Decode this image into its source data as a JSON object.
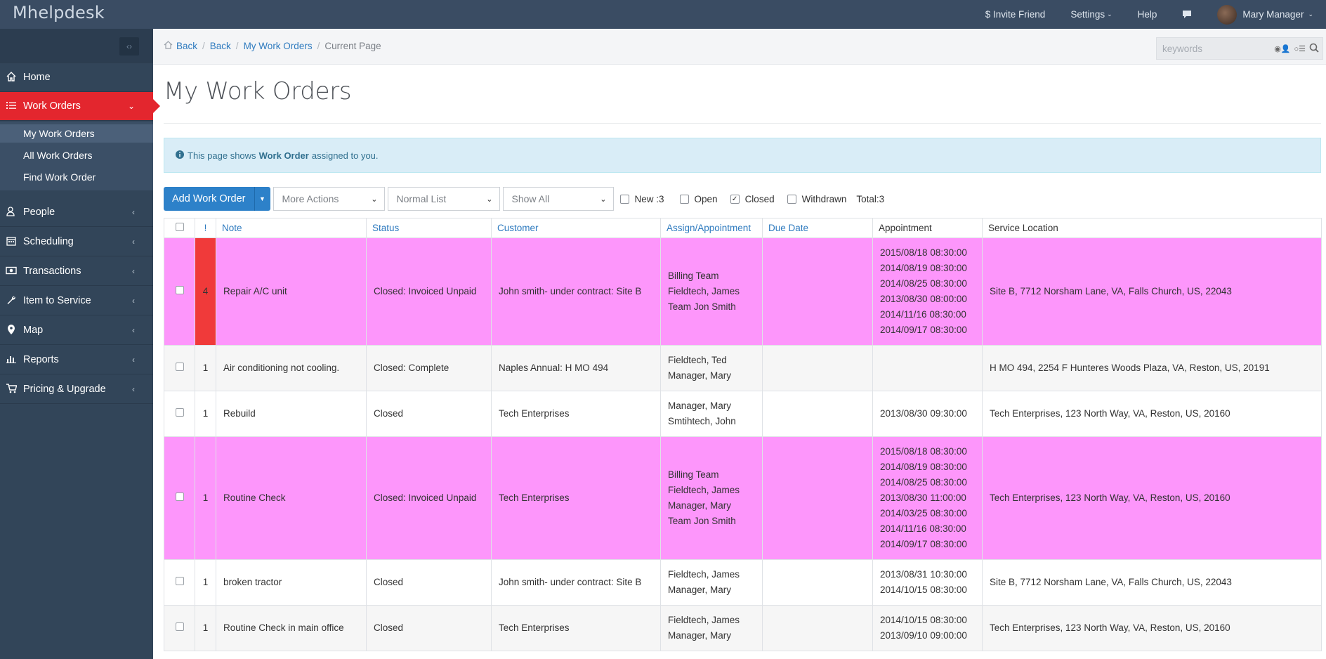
{
  "topbar": {
    "brand": "Mhelpdesk",
    "invite": "$ Invite Friend",
    "settings": "Settings",
    "help": "Help",
    "user": "Mary Manager"
  },
  "sidebar": {
    "items": [
      {
        "label": "Home",
        "icon": "home-icon"
      },
      {
        "label": "Work Orders",
        "icon": "list-icon"
      },
      {
        "label": "People",
        "icon": "people-icon"
      },
      {
        "label": "Scheduling",
        "icon": "calendar-icon"
      },
      {
        "label": "Transactions",
        "icon": "money-icon"
      },
      {
        "label": "Item to Service",
        "icon": "wrench-icon"
      },
      {
        "label": "Map",
        "icon": "map-pin-icon"
      },
      {
        "label": "Reports",
        "icon": "bar-chart-icon"
      },
      {
        "label": "Pricing & Upgrade",
        "icon": "cart-icon"
      }
    ],
    "sub_items": [
      "My Work Orders",
      "All Work Orders",
      "Find Work Order"
    ]
  },
  "breadcrumb": {
    "back1": "Back",
    "back2": "Back",
    "link": "My Work Orders",
    "current": "Current Page"
  },
  "search": {
    "placeholder": "keywords"
  },
  "page": {
    "title": "My Work Orders",
    "info_prefix": "This page shows",
    "info_bold": "Work Order",
    "info_suffix": "assigned to you."
  },
  "toolbar": {
    "add_label": "Add Work Order",
    "more_actions": "More Actions",
    "list_mode": "Normal List",
    "show": "Show All",
    "filters": [
      {
        "label": "New :3",
        "checked": false
      },
      {
        "label": "Open",
        "checked": false
      },
      {
        "label": "Closed",
        "checked": true
      },
      {
        "label": "Withdrawn",
        "checked": false
      }
    ],
    "total": "Total:3"
  },
  "table": {
    "headers": [
      "!",
      "Note",
      "Status",
      "Customer",
      "Assign/Appointment",
      "Due Date",
      "Appointment",
      "Service Location"
    ],
    "rows": [
      {
        "style": "pink",
        "prio": "4",
        "note": "Repair A/C unit",
        "status": "Closed: Invoiced Unpaid",
        "customer": "John smith- under contract: Site B",
        "assign": [
          "Billing Team",
          "Fieldtech, James",
          "Team Jon Smith"
        ],
        "due": "",
        "appt": [
          "2015/08/18 08:30:00",
          "2014/08/19 08:30:00",
          "2014/08/25 08:30:00",
          "2013/08/30 08:00:00",
          "2014/11/16 08:30:00",
          "2014/09/17 08:30:00"
        ],
        "location": "Site B, 7712 Norsham Lane, VA, Falls Church, US, 22043"
      },
      {
        "style": "grey",
        "prio": "1",
        "note": "Air conditioning not cooling.",
        "status": "Closed: Complete",
        "customer": "Naples Annual: H MO 494",
        "assign": [
          "Fieldtech, Ted",
          "Manager, Mary"
        ],
        "due": "",
        "appt": [],
        "location": "H MO 494, 2254 F Hunteres Woods Plaza, VA, Reston, US, 20191"
      },
      {
        "style": "white",
        "prio": "1",
        "note": "Rebuild",
        "status": "Closed",
        "customer": "Tech Enterprises",
        "assign": [
          "Manager, Mary",
          "Smtihtech, John"
        ],
        "due": "",
        "appt": [
          "2013/08/30 09:30:00"
        ],
        "location": "Tech Enterprises, 123 North Way, VA, Reston, US, 20160"
      },
      {
        "style": "pink",
        "prio": "1",
        "note": "Routine Check",
        "status": "Closed: Invoiced Unpaid",
        "customer": "Tech Enterprises",
        "assign": [
          "Billing Team",
          "Fieldtech, James",
          "Manager, Mary",
          "Team Jon Smith"
        ],
        "due": "",
        "appt": [
          "2015/08/18 08:30:00",
          "2014/08/19 08:30:00",
          "2014/08/25 08:30:00",
          "2013/08/30 11:00:00",
          "2014/03/25 08:30:00",
          "2014/11/16 08:30:00",
          "2014/09/17 08:30:00"
        ],
        "location": "Tech Enterprises, 123 North Way, VA, Reston, US, 20160"
      },
      {
        "style": "white",
        "prio": "1",
        "note": "broken tractor",
        "status": "Closed",
        "customer": "John smith- under contract: Site B",
        "assign": [
          "Fieldtech, James",
          "Manager, Mary"
        ],
        "due": "",
        "appt": [
          "2013/08/31 10:30:00",
          "2014/10/15 08:30:00"
        ],
        "location": "Site B, 7712 Norsham Lane, VA, Falls Church, US, 22043"
      },
      {
        "style": "grey",
        "prio": "1",
        "note": "Routine Check in main office",
        "status": "Closed",
        "customer": "Tech Enterprises",
        "assign": [
          "Fieldtech, James",
          "Manager, Mary"
        ],
        "due": "",
        "appt": [
          "2014/10/15 08:30:00",
          "2013/09/10 09:00:00"
        ],
        "location": "Tech Enterprises, 123 North Way, VA, Reston, US, 20160"
      }
    ]
  }
}
